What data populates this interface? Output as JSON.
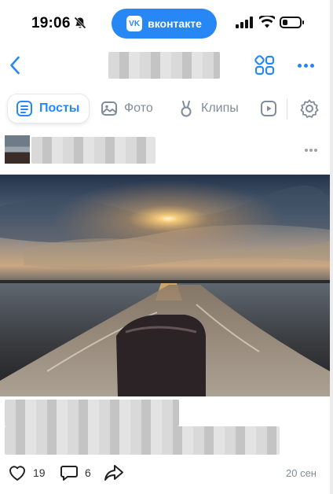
{
  "status_bar": {
    "time": "19:06",
    "app_pill_label": "вконтакте",
    "app_pill_logo": "VK",
    "battery_level": 0.3
  },
  "nav": {
    "back_icon": "chevron-left-icon",
    "grid_icon": "grid-icon",
    "more_icon": "more-horizontal-icon"
  },
  "tabs": [
    {
      "label": "Посты",
      "icon": "posts-icon",
      "active": true
    },
    {
      "label": "Фото",
      "icon": "photo-icon",
      "active": false
    },
    {
      "label": "Клипы",
      "icon": "clips-icon",
      "active": false
    }
  ],
  "post": {
    "likes": "19",
    "comments": "6",
    "date": "20 сен"
  },
  "colors": {
    "accent": "#2787f5",
    "secondary_text": "#818c99",
    "background": "#ffffff"
  }
}
